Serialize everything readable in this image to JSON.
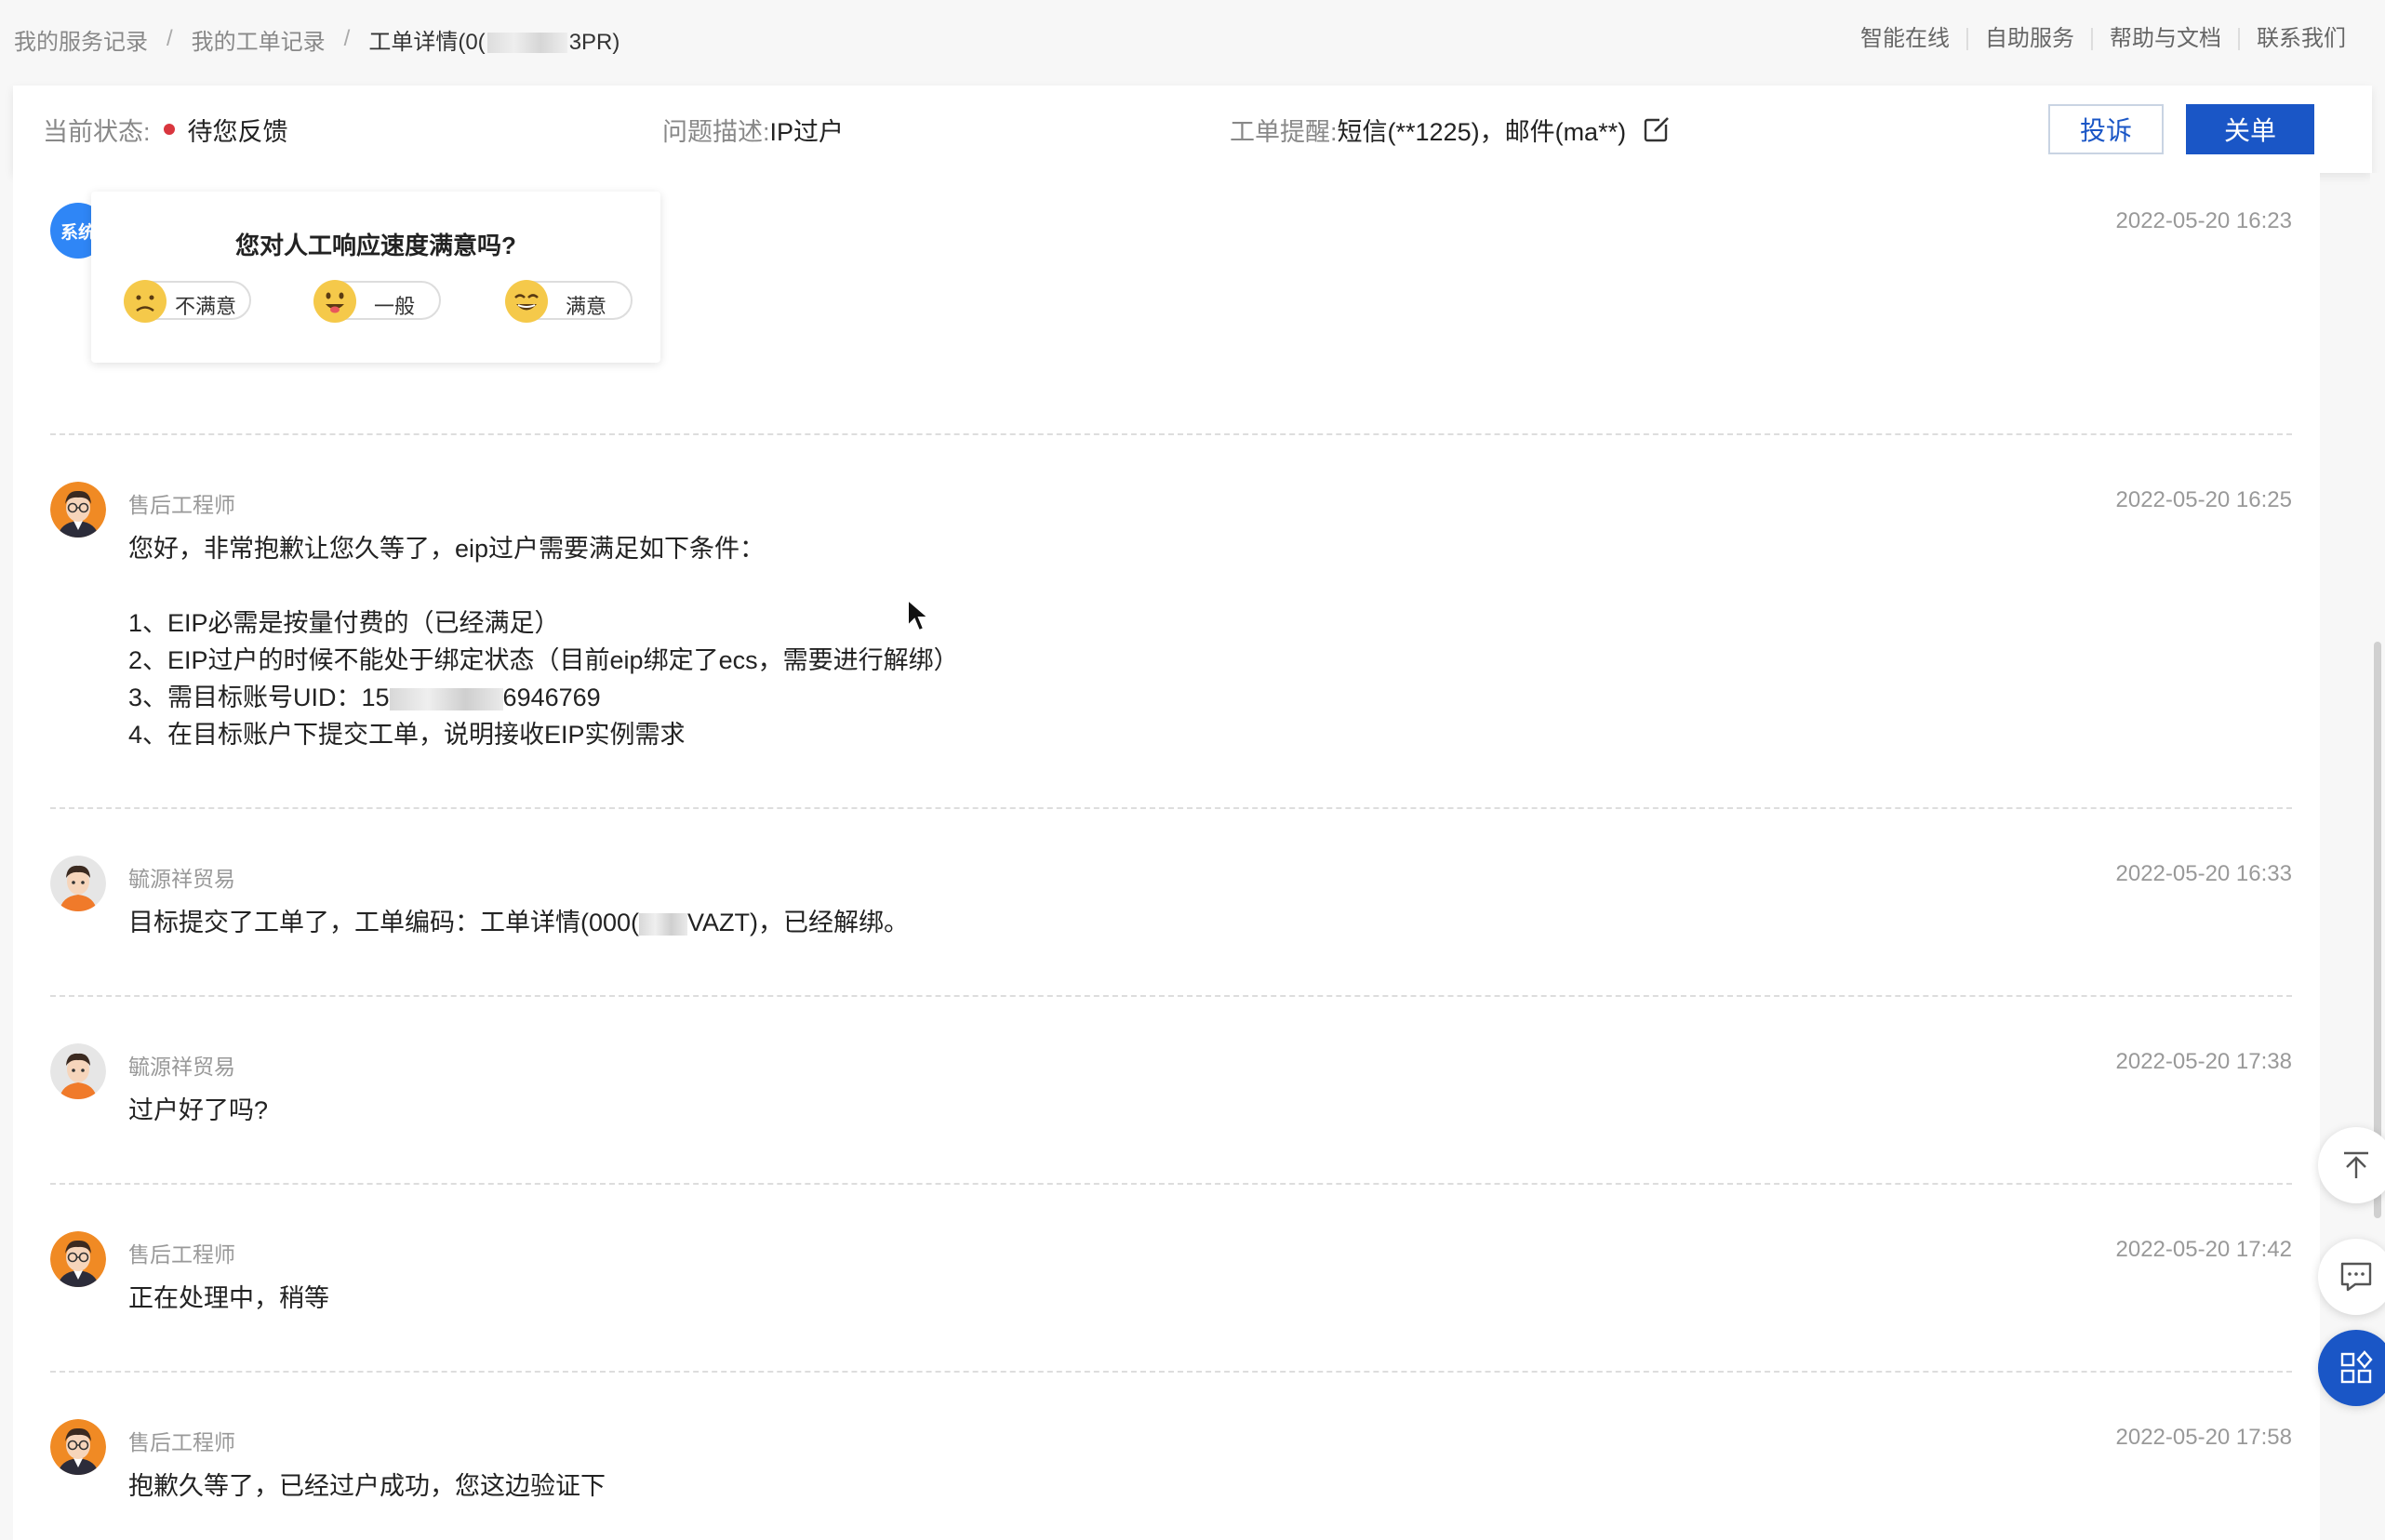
{
  "breadcrumb": {
    "item1": "我的服务记录",
    "item2": "我的工单记录",
    "current_prefix": "工单详情(0(",
    "current_suffix": "3PR)",
    "separator": "/"
  },
  "topnav": [
    "智能在线",
    "自助服务",
    "帮助与文档",
    "联系我们"
  ],
  "status": {
    "state_label": "当前状态:",
    "state_value": "待您反馈",
    "state_color": "#d9363e",
    "desc_label": "问题描述:",
    "desc_value": "IP过户",
    "remind_label": "工单提醒:",
    "remind_value": "短信(**1225)，邮件(ma**)",
    "edit_icon": "edit-icon"
  },
  "buttons": {
    "complain": "投诉",
    "close_ticket": "关单"
  },
  "survey": {
    "sender_badge": "系统",
    "time": "2022-05-20 16:23",
    "question": "您对人工响应速度满意吗?",
    "options": [
      "不满意",
      "一般",
      "满意"
    ]
  },
  "messages": [
    {
      "sender": "售后工程师",
      "time": "2022-05-20 16:25",
      "lines": [
        "您好，非常抱歉让您久等了，eip过户需要满足如下条件：",
        "",
        "1、EIP必需是按量付费的（已经满足）",
        "2、EIP过户的时候不能处于绑定状态（目前eip绑定了ecs，需要进行解绑）",
        "3、需目标账号UID：15",
        "6946769",
        "4、在目标账户下提交工单，说明接收EIP实例需求"
      ]
    },
    {
      "sender": "毓源祥贸易",
      "time": "2022-05-20 16:33",
      "text_prefix": "目标提交了工单了，工单编码：工单详情(000(",
      "text_suffix": "VAZT)，已经解绑。"
    },
    {
      "sender": "毓源祥贸易",
      "time": "2022-05-20 17:38",
      "text": "过户好了吗?"
    },
    {
      "sender": "售后工程师",
      "time": "2022-05-20 17:42",
      "text": "正在处理中，稍等"
    },
    {
      "sender": "售后工程师",
      "time": "2022-05-20 17:58",
      "text": "抱歉久等了，已经过户成功，您这边验证下"
    }
  ],
  "side_tools": [
    "back-to-top-icon",
    "chat-icon",
    "apps-icon"
  ]
}
